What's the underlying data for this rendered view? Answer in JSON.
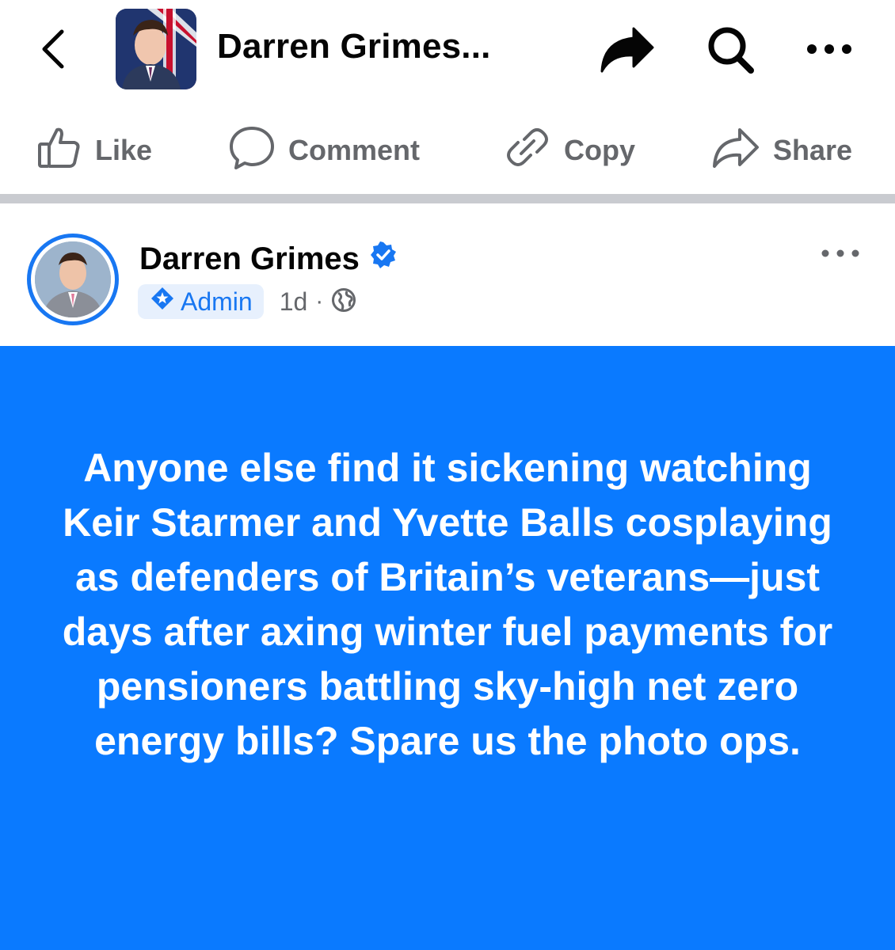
{
  "header": {
    "page_title": "Darren Grimes...",
    "icons": [
      "back-icon",
      "share-arrow-icon",
      "search-icon",
      "more-icon"
    ]
  },
  "actions": [
    {
      "label": "Like",
      "icon": "thumbs-up-icon"
    },
    {
      "label": "Comment",
      "icon": "comment-icon"
    },
    {
      "label": "Copy",
      "icon": "link-icon"
    },
    {
      "label": "Share",
      "icon": "share-icon"
    }
  ],
  "post": {
    "author": "Darren Grimes",
    "role_badge": "Admin",
    "time": "1d",
    "separator": "·",
    "audience_icon": "globe-icon",
    "text": "Anyone else find it sickening watching Keir Starmer and Yvette Balls cosplaying as defenders of Britain’s veterans—just days after axing winter fuel payments for pensioners battling sky-high net zero energy bills? Spare us the photo ops."
  },
  "colors": {
    "accent": "#1877f2",
    "post_background": "#0a7aff",
    "muted_text": "#65676b",
    "divider": "#c9cbd0"
  }
}
